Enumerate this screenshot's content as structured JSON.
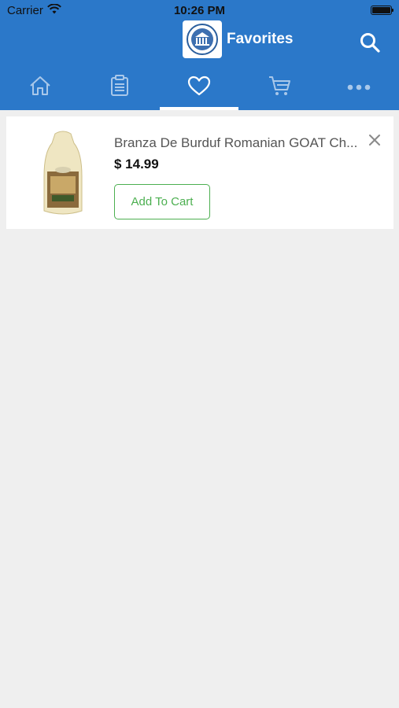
{
  "status_bar": {
    "carrier": "Carrier",
    "time": "10:26 PM"
  },
  "header": {
    "title": "Favorites",
    "logo_icon": "building-seal-logo",
    "search_icon": "search-icon"
  },
  "tabs": [
    {
      "name": "home",
      "icon": "home-icon",
      "active": false
    },
    {
      "name": "orders",
      "icon": "clipboard-icon",
      "active": false
    },
    {
      "name": "favorites",
      "icon": "heart-icon",
      "active": true
    },
    {
      "name": "cart",
      "icon": "cart-icon",
      "active": false
    },
    {
      "name": "more",
      "icon": "more-dots-icon",
      "active": false
    }
  ],
  "favorites": [
    {
      "name": "Branza De Burduf Romanian GOAT Ch...",
      "price": "$ 14.99",
      "add_label": "Add To Cart"
    }
  ],
  "colors": {
    "brand": "#2b78c9",
    "accent_green": "#4caf50",
    "background": "#efefef"
  }
}
